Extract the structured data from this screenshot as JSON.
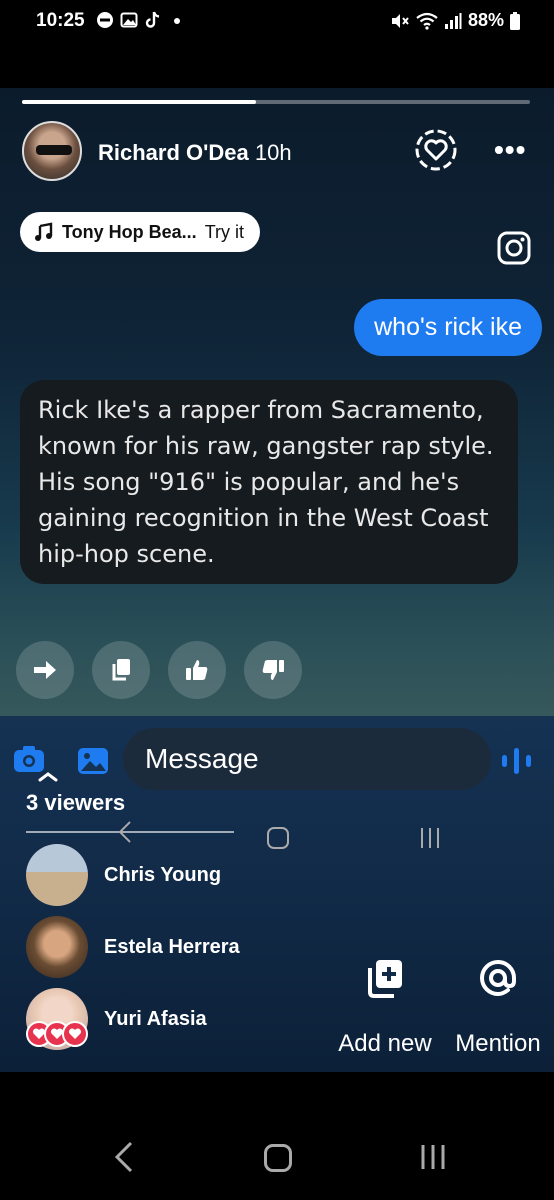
{
  "status": {
    "time": "10:25",
    "battery": "88%",
    "left_icons": [
      "dnd-icon",
      "gallery-icon",
      "tiktok-icon",
      "dot-icon"
    ],
    "right_icons": [
      "mute-icon",
      "wifi-icon",
      "signal-icon",
      "battery-icon"
    ]
  },
  "story": {
    "progress": 0.46,
    "author": "Richard O'Dea",
    "time_ago": "10h",
    "music": {
      "song": "Tony Hop Bea...",
      "cta": "Try it"
    },
    "user_message": "who's rick ike",
    "ai_reply": "Rick Ike's a rapper from Sacramento, known for his raw, gangster rap style. His song \"916\" is popular, and he's gaining recognition in the West Coast hip-hop scene.",
    "actions": [
      "share-icon",
      "copy-icon",
      "thumbs-up-icon",
      "thumbs-down-icon"
    ]
  },
  "composer": {
    "placeholder": "Message"
  },
  "viewers": {
    "count_label": "3 viewers",
    "list": [
      {
        "name": "Chris Young"
      },
      {
        "name": "Estela Herrera"
      },
      {
        "name": "Yuri Afasia"
      }
    ]
  },
  "quick_actions": {
    "add_new": "Add new",
    "mention": "Mention"
  },
  "colors": {
    "accent": "#1f7cf0",
    "bubble_ai": "#151b1f",
    "panel": "#112a47",
    "reaction": "#e8334f"
  }
}
